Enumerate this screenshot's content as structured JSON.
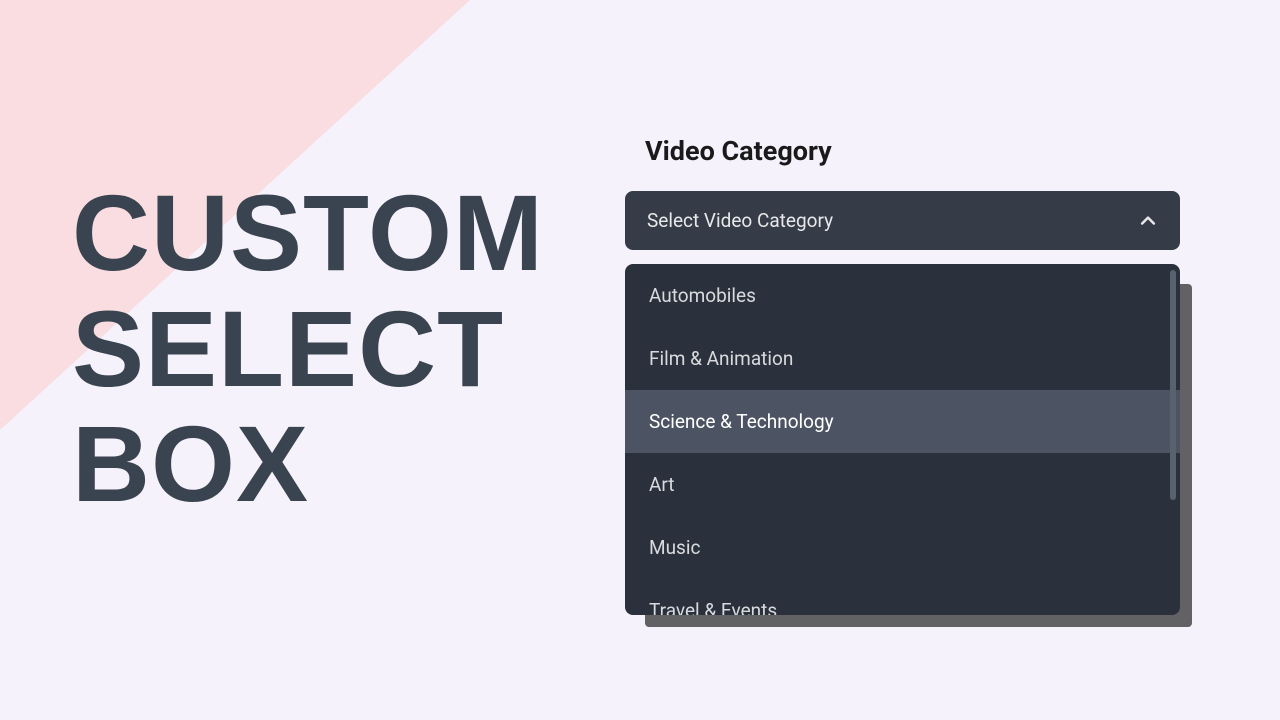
{
  "headline": {
    "line1": "CUSTOM",
    "line2": "SELECT",
    "line3": "BOX"
  },
  "widget": {
    "label": "Video Category",
    "placeholder": "Select Video Category",
    "options": [
      {
        "label": "Automobiles",
        "highlighted": false
      },
      {
        "label": "Film & Animation",
        "highlighted": false
      },
      {
        "label": "Science & Technology",
        "highlighted": true
      },
      {
        "label": "Art",
        "highlighted": false
      },
      {
        "label": "Music",
        "highlighted": false
      },
      {
        "label": "Travel & Events",
        "highlighted": false
      }
    ]
  },
  "colors": {
    "bg": "#f5f2fb",
    "accentPink": "#f9dde0",
    "headline": "#3a4450",
    "selectHeader": "#353c48",
    "dropdown": "#2b313c",
    "highlight": "#4c5463"
  }
}
